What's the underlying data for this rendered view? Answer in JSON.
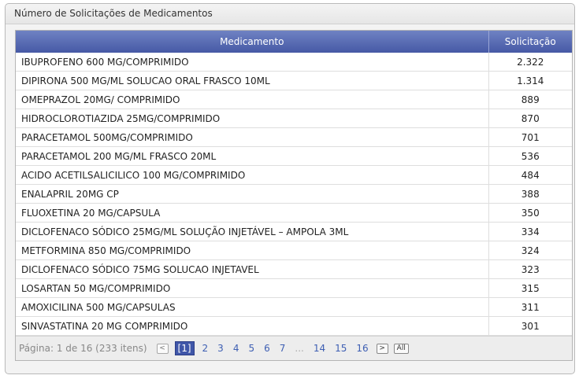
{
  "panel": {
    "title": "Número de Solicitações de Medicamentos"
  },
  "table": {
    "columns": [
      "Medicamento",
      "Solicitação"
    ],
    "rows": [
      [
        "IBUPROFENO 600 MG/COMPRIMIDO",
        "2.322"
      ],
      [
        "DIPIRONA 500 MG/ML SOLUCAO ORAL FRASCO 10ML",
        "1.314"
      ],
      [
        "OMEPRAZOL 20MG/ COMPRIMIDO",
        "889"
      ],
      [
        "HIDROCLOROTIAZIDA 25MG/COMPRIMIDO",
        "870"
      ],
      [
        "PARACETAMOL 500MG/COMPRIMIDO",
        "701"
      ],
      [
        "PARACETAMOL 200 MG/ML FRASCO 20ML",
        "536"
      ],
      [
        "ACIDO ACETILSALICILICO 100 MG/COMPRIMIDO",
        "484"
      ],
      [
        "ENALAPRIL 20MG CP",
        "388"
      ],
      [
        "FLUOXETINA 20 MG/CAPSULA",
        "350"
      ],
      [
        "DICLOFENACO SÓDICO 25MG/ML SOLUÇÃO INJETÁVEL – AMPOLA 3ML",
        "334"
      ],
      [
        "METFORMINA 850 MG/COMPRIMIDO",
        "324"
      ],
      [
        "DICLOFENACO SÓDICO 75MG SOLUCAO INJETAVEL",
        "323"
      ],
      [
        "LOSARTAN 50 MG/COMPRIMIDO",
        "315"
      ],
      [
        "AMOXICILINA 500 MG/CAPSULAS",
        "311"
      ],
      [
        "SINVASTATINA 20 MG COMPRIMIDO",
        "301"
      ]
    ]
  },
  "pager": {
    "summary": "Página: 1 de 16 (233 itens)",
    "prev_label": "<",
    "current_label": "[1]",
    "pages": [
      "2",
      "3",
      "4",
      "5",
      "6",
      "7"
    ],
    "ellipsis": "...",
    "tail_pages": [
      "14",
      "15",
      "16"
    ],
    "next_label": ">",
    "all_label": "All"
  },
  "colors": {
    "header_bg": "#4f62ac",
    "current_page_bg": "#3f56a8",
    "link": "#3e5fb3"
  }
}
